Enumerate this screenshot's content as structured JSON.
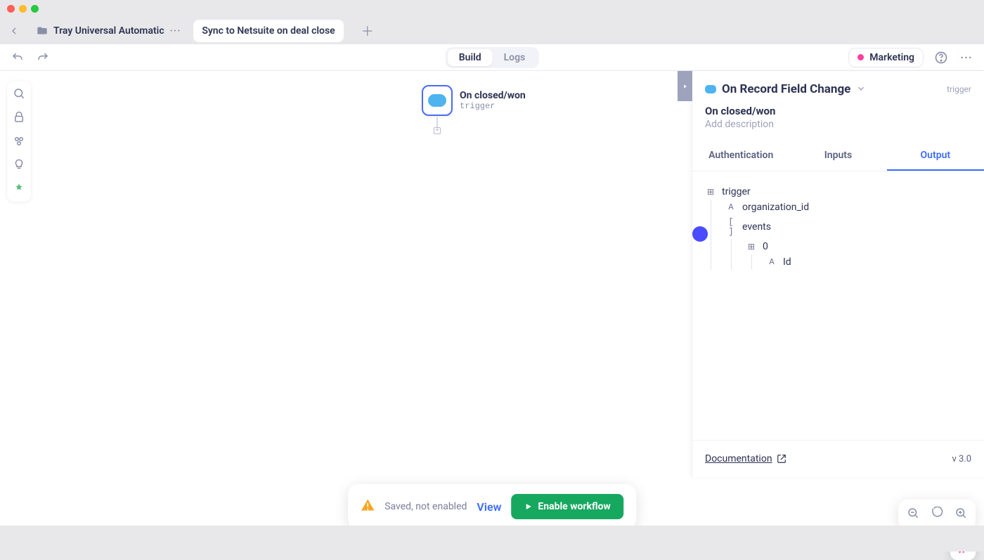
{
  "tabs": {
    "project": "Tray Universal Automatic",
    "workflow": "Sync to Netsuite on deal close"
  },
  "toolbar": {
    "build": "Build",
    "logs": "Logs",
    "workspace": "Marketing"
  },
  "node": {
    "title": "On closed/won",
    "subtitle": "trigger"
  },
  "panel": {
    "title": "On Record Field Change",
    "kind": "trigger",
    "subtitle": "On closed/won",
    "description_placeholder": "Add description",
    "tabs": {
      "auth": "Authentication",
      "inputs": "Inputs",
      "output": "Output"
    },
    "tree": {
      "root": "trigger",
      "org": "organization_id",
      "events": "events",
      "idx0": "0",
      "id": "Id"
    },
    "doc": "Documentation",
    "version": "v 3.0"
  },
  "status": {
    "text": "Saved, not enabled",
    "view": "View",
    "enable": "Enable workflow"
  }
}
